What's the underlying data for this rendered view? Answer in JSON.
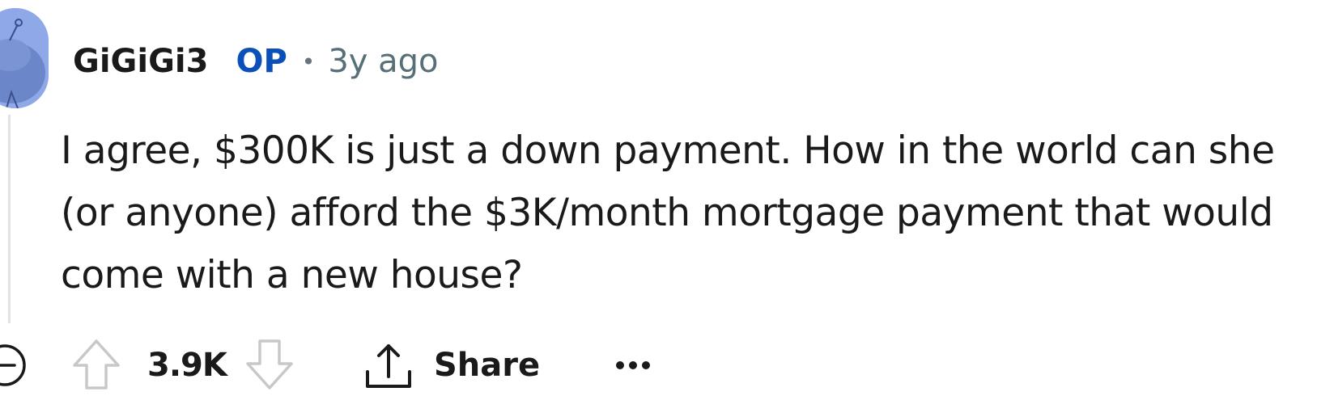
{
  "comment": {
    "author": "GiGiGi3",
    "op_badge": "OP",
    "separator": "•",
    "timestamp": "3y ago",
    "body": "I agree, $300K is just a down payment. How in the world can she (or anyone) afford the $3K/month mortgage payment that would come with a new house?"
  },
  "actions": {
    "score": "3.9K",
    "share_label": "Share",
    "more_label": "•••"
  },
  "icons": {
    "avatar": "snoo-avatar-icon",
    "collapse": "collapse-minus-icon",
    "upvote": "upvote-arrow-icon",
    "downvote": "downvote-arrow-icon",
    "share": "share-upload-icon",
    "more": "more-options-icon"
  },
  "colors": {
    "op_badge": "#0b4fb8",
    "timestamp": "#576f76",
    "avatar_bg": "#8fa8e8",
    "thread_line": "#e0e2e4"
  }
}
